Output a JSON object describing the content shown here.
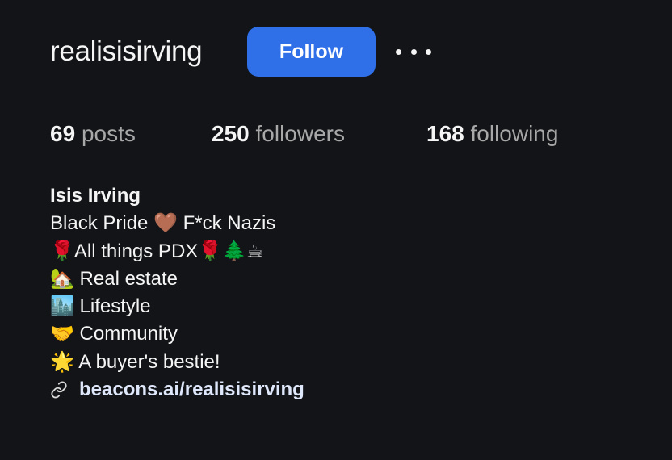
{
  "profile": {
    "username": "realisisirving",
    "follow_label": "Follow",
    "more_label": "More options"
  },
  "stats": {
    "posts": {
      "count": "69",
      "label": "posts"
    },
    "followers": {
      "count": "250",
      "label": "followers"
    },
    "following": {
      "count": "168",
      "label": "following"
    }
  },
  "bio": {
    "name": "Isis Irving",
    "lines": [
      "Black Pride 🤎 F*ck Nazis",
      "🌹All things PDX🌹🌲☕",
      "🏡 Real estate",
      "🏙️ Lifestyle",
      "🤝 Community",
      "🌟 A buyer's bestie!"
    ],
    "link": "beacons.ai/realisisirving",
    "link_icon": "link-icon"
  },
  "colors": {
    "background": "#121417",
    "follow_button": "#2f6fe8",
    "primary_text": "#f5f5f5",
    "secondary_text": "#a8a8a8",
    "link_text": "#dfe8fb"
  }
}
